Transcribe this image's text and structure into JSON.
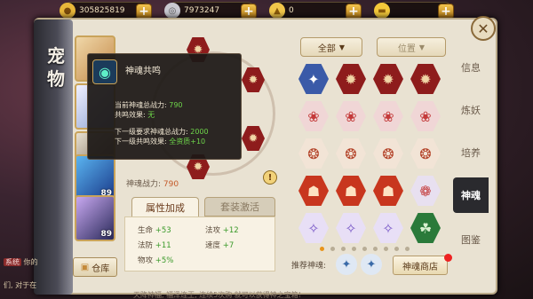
{
  "currency": {
    "coins": "305825819",
    "silver": "7973247",
    "gold_ingot": "0",
    "premium": ""
  },
  "panel": {
    "title": "宠物",
    "close_glyph": "✕"
  },
  "pets": [
    {
      "level": "0"
    },
    {
      "level": ""
    },
    {
      "level": ""
    },
    {
      "level": "89"
    },
    {
      "level": "89"
    },
    {
      "level": ""
    }
  ],
  "storage_label": "仓库",
  "tooltip": {
    "title": "神魂共鸣",
    "total_power_label": "当前神魂总战力:",
    "total_power_value": "790",
    "effect_label": "共鸣效果:",
    "effect_value": "无",
    "next_power_label": "下一级要求神魂总战力:",
    "next_power_value": "2000",
    "next_effect_label": "下一级共鸣效果:",
    "next_effect_value": "全资质+10"
  },
  "soul_power": {
    "label": "神魂战力:",
    "value": "790"
  },
  "tabs": {
    "attributes": "属性加成",
    "set_activate": "套装激活"
  },
  "attributes": [
    {
      "name": "生命",
      "value": "+53"
    },
    {
      "name": "法攻",
      "value": "+12"
    },
    {
      "name": "法防",
      "value": "+11"
    },
    {
      "name": "速度",
      "value": "+7"
    },
    {
      "name": "物攻",
      "value": "+5%"
    }
  ],
  "filters": {
    "category": "全部",
    "position": "位置"
  },
  "grid_page": {
    "total": 9,
    "current": 0
  },
  "recommend_label": "推荐神魂:",
  "shop_label": "神魂商店",
  "side_tabs": [
    "信息",
    "炼妖",
    "培养",
    "神魂",
    "图鉴"
  ],
  "side_tab_active": 3,
  "chat": [
    {
      "tag": "系统",
      "text": "你的"
    },
    {
      "tag": "",
      "text": "们, 对于在"
    }
  ],
  "bottom_text": "天降神福, 福泽连王, 连续5次购 就可以获得神之宝箱!"
}
